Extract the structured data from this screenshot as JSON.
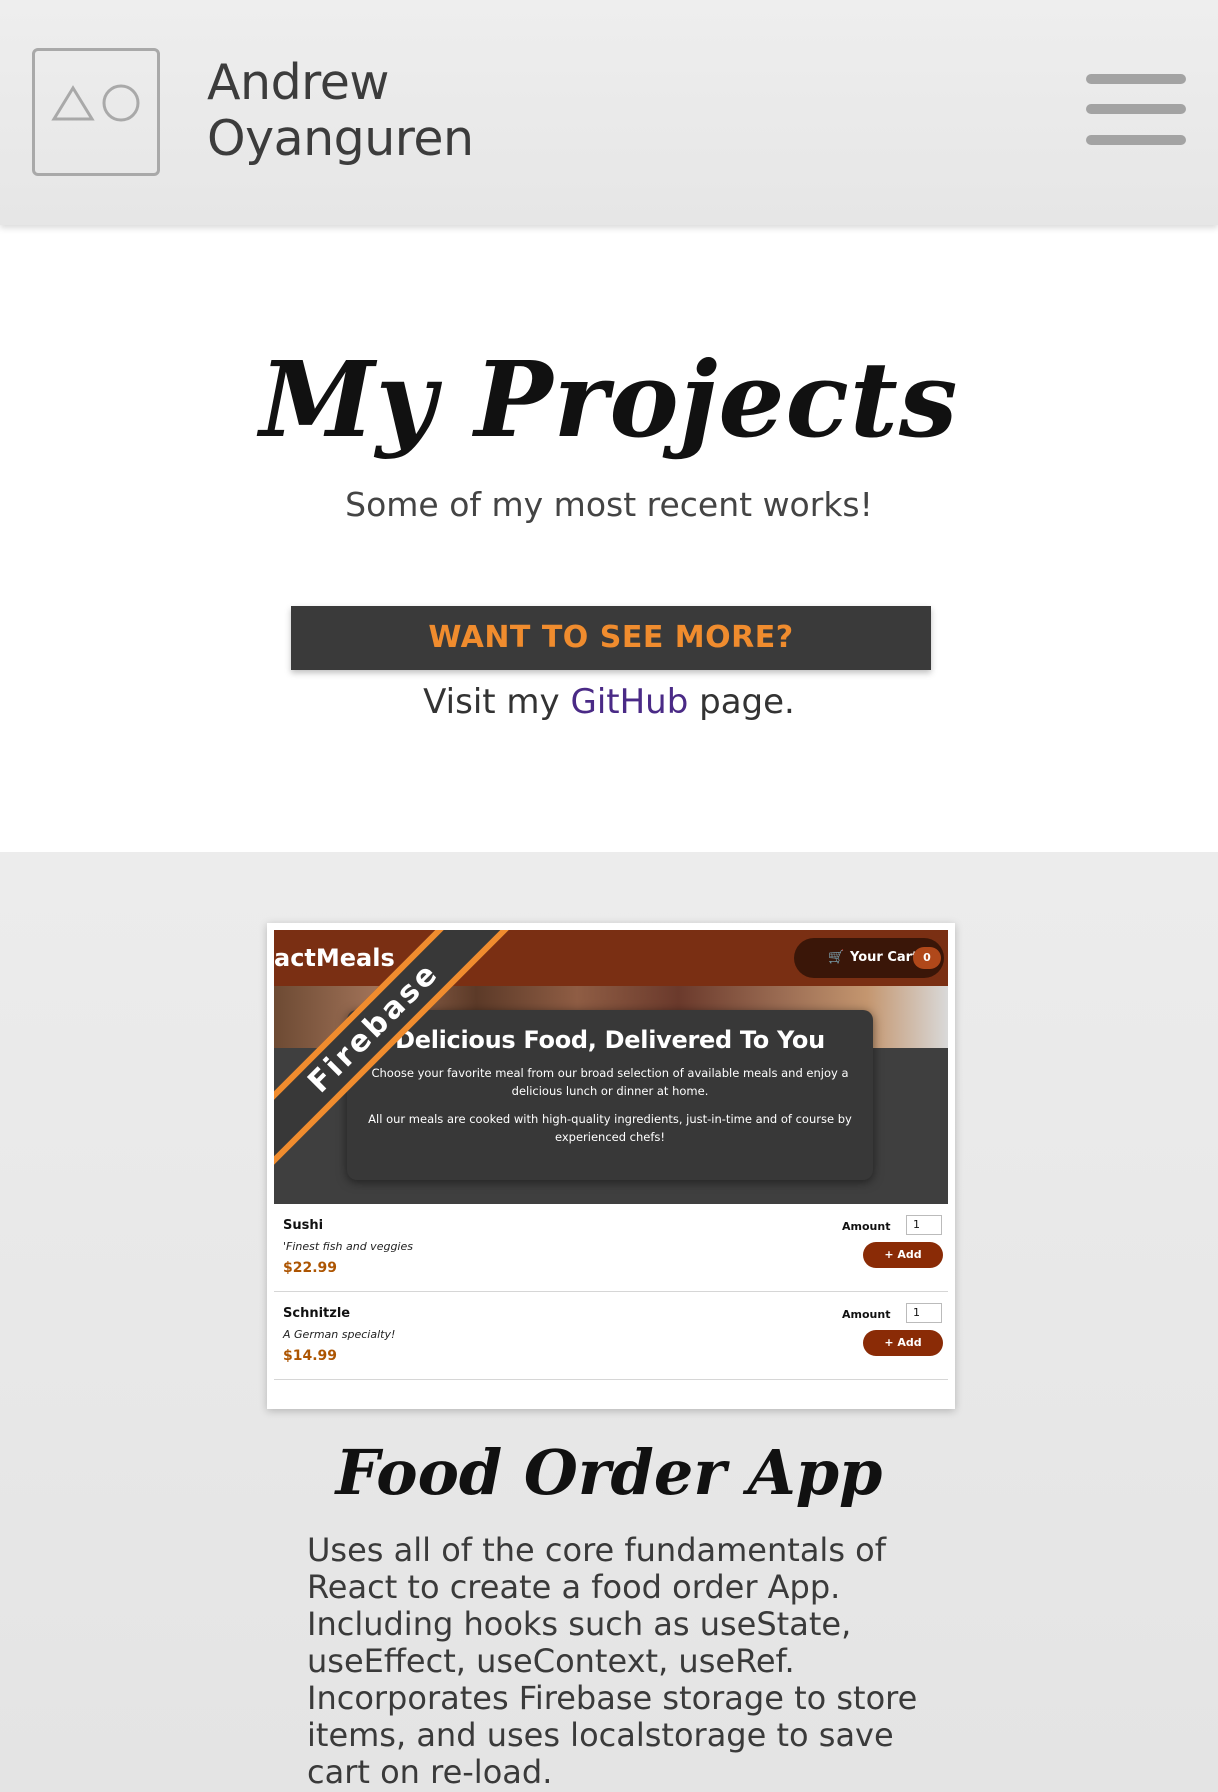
{
  "header": {
    "name_line1": "Andrew",
    "name_line2": "Oyanguren",
    "logo_icon": "triangle-circle-logo",
    "menu_icon": "hamburger-menu-icon"
  },
  "intro": {
    "title": "My Projects",
    "subtitle": "Some of my most recent works!",
    "more_button": "WANT TO SEE MORE?",
    "visit_prefix": "Visit my",
    "visit_link": "GitHub",
    "visit_suffix": "page."
  },
  "project": {
    "ribbon": "Firebase",
    "screenshot": {
      "brand": "actMeals",
      "cart_label": "Your Cart",
      "cart_count": "0",
      "headline": "Delicious Food, Delivered To You",
      "para1": "Choose your favorite meal from our broad selection of available meals and enjoy a delicious lunch or dinner at home.",
      "para2": "All our meals are cooked with high-quality ingredients, just-in-time and of course by experienced chefs!",
      "meals": [
        {
          "name": "Sushi",
          "desc": "'Finest fish and veggies",
          "price": "$22.99",
          "amount_label": "Amount",
          "amount": "1",
          "add_label": "+ Add"
        },
        {
          "name": "Schnitzle",
          "desc": "A German specialty!",
          "price": "$14.99",
          "amount_label": "Amount",
          "amount": "1",
          "add_label": "+ Add"
        }
      ]
    },
    "title": "Food Order App",
    "description": "Uses all of the core fundamentals of React to create a food order App. Including hooks such as useState, useEffect, useContext, useRef. Incorporates Firebase storage to store items, and uses localstorage to save cart on re-load."
  },
  "colors": {
    "accent_orange": "#f08c2e",
    "dark": "#3a3a3a",
    "link_purple": "#4a2a86",
    "app_brown": "#7a2f13"
  }
}
